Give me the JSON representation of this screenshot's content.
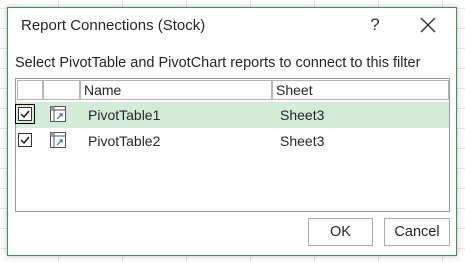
{
  "dialog": {
    "title": "Report Connections (Stock)",
    "help_label": "?",
    "subtitle": "Select PivotTable and PivotChart reports to connect to this filter"
  },
  "table": {
    "columns": [
      "Name",
      "Sheet"
    ],
    "rows": [
      {
        "checked": true,
        "name": "PivotTable1",
        "sheet": "Sheet3",
        "selected": true
      },
      {
        "checked": true,
        "name": "PivotTable2",
        "sheet": "Sheet3",
        "selected": false
      }
    ]
  },
  "buttons": {
    "ok": "OK",
    "cancel": "Cancel"
  },
  "colors": {
    "selection": "#d3ecd9",
    "border_accent": "#4a8a5a"
  },
  "icons": {
    "row_icon": "pivottable-icon",
    "check": "checkmark-icon",
    "close": "close-icon"
  }
}
